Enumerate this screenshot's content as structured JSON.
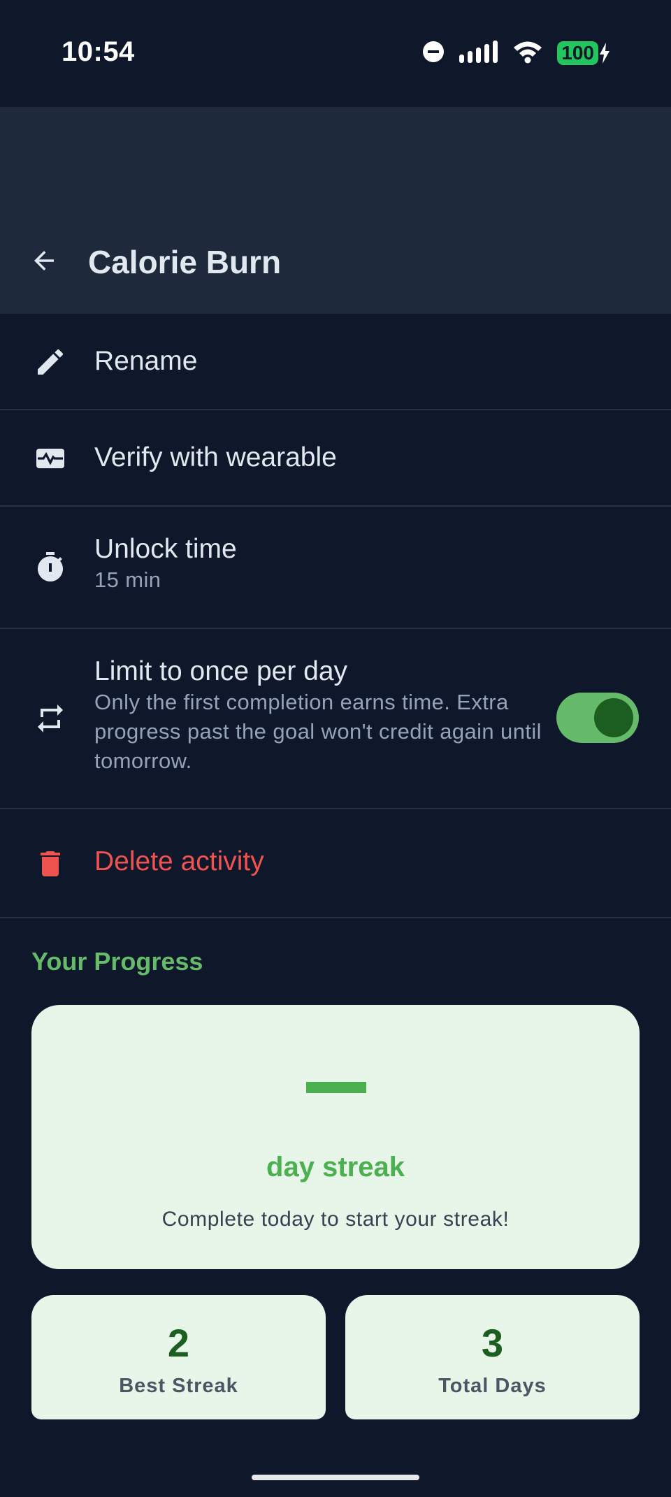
{
  "status_bar": {
    "time": "10:54",
    "battery": "100",
    "icons": [
      "do-not-disturb-icon",
      "signal-icon",
      "wifi-icon",
      "battery-icon",
      "charging-icon"
    ]
  },
  "app_bar": {
    "title": "Calorie Burn",
    "back_icon": "arrow-left-icon"
  },
  "menu": {
    "rename": {
      "label": "Rename",
      "icon": "pencil-icon"
    },
    "verify": {
      "label": "Verify with wearable",
      "icon": "heartbeat-monitor-icon"
    },
    "unlock_time": {
      "label": "Unlock time",
      "value": "15 min",
      "icon": "timer-icon"
    },
    "limit": {
      "label": "Limit to once per day",
      "description": "Only the first completion earns time. Extra progress past the goal won't credit again until tomorrow.",
      "icon": "repeat-icon",
      "enabled": true
    },
    "delete": {
      "label": "Delete activity",
      "icon": "trash-icon"
    }
  },
  "progress": {
    "section_title": "Your Progress",
    "streak_value": "—",
    "streak_label": "day streak",
    "streak_hint": "Complete today to start your streak!",
    "best_streak": {
      "value": "2",
      "label": "Best Streak"
    },
    "total_days": {
      "value": "3",
      "label": "Total Days"
    }
  },
  "colors": {
    "background": "#0f172a",
    "app_bar": "#1e293b",
    "accent": "#66bb6a",
    "danger": "#ef5350",
    "card": "#e8f5e9"
  }
}
